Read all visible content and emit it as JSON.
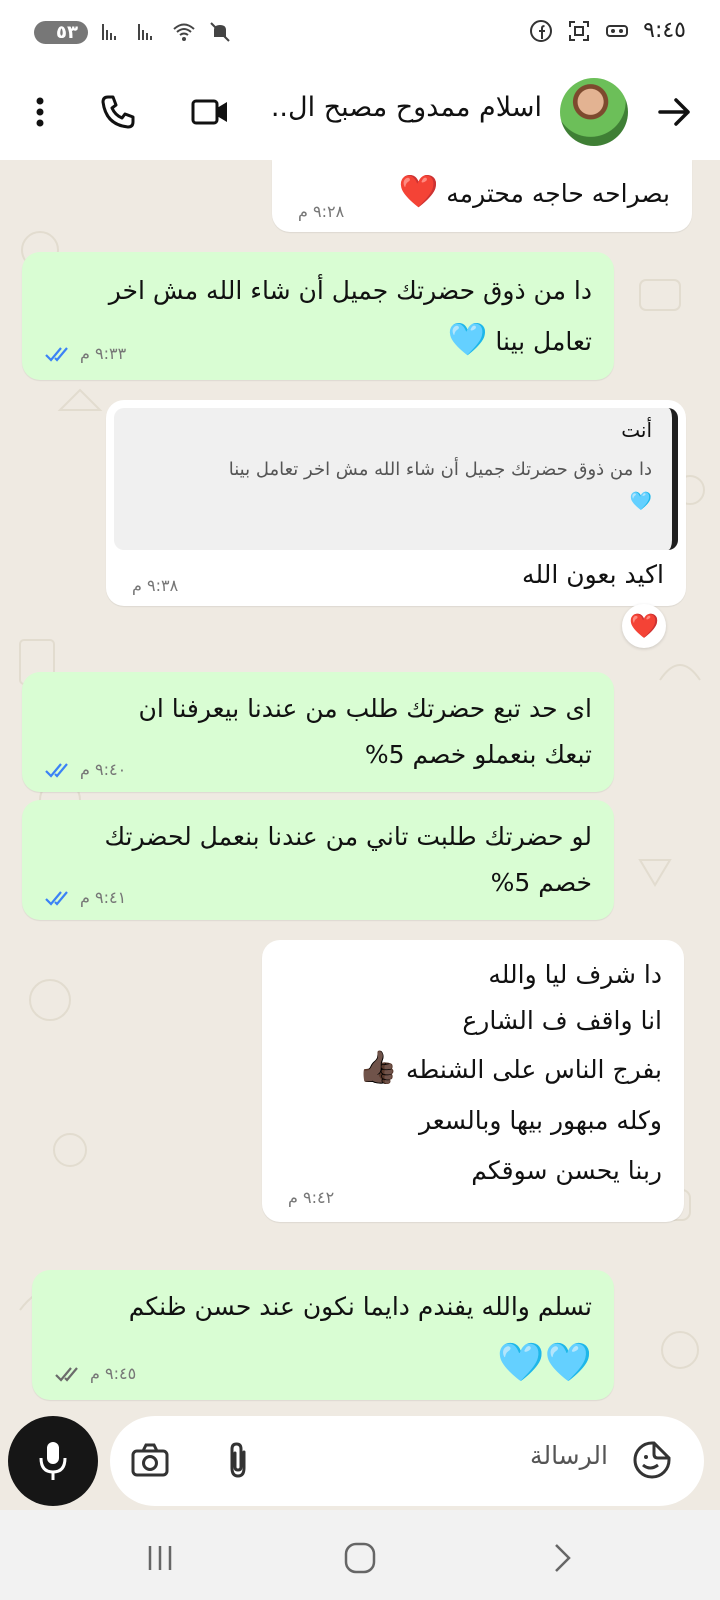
{
  "status_bar": {
    "time": "٩:٤٥",
    "battery": "٥٣"
  },
  "header": {
    "contact_name": "اسلام ممدوح مصبح ال.."
  },
  "messages": [
    {
      "dir": "in",
      "lines": [
        "بصراحه حاجه محترمه"
      ],
      "emoji": "❤️",
      "time": "٩:٢٨ م"
    },
    {
      "dir": "out",
      "lines": [
        "دا من ذوق حضرتك جميل أن شاء الله مش اخر",
        "تعامل بينا"
      ],
      "emoji": "🩵",
      "time": "٩:٣٣ م"
    },
    {
      "dir": "in",
      "quote_author": "أنت",
      "quote_text": "دا من ذوق حضرتك جميل أن شاء الله مش اخر تعامل بينا",
      "quote_emoji": "🩵",
      "lines": [
        "اكيد بعون الله"
      ],
      "time": "٩:٣٨ م",
      "reaction": "❤️"
    },
    {
      "dir": "out",
      "lines": [
        "اى حد تبع حضرتك طلب من عندنا بيعرفنا ان",
        "تبعك بنعملو خصم 5%"
      ],
      "time": "٩:٤٠ م"
    },
    {
      "dir": "out",
      "lines": [
        "لو حضرتك طلبت تاني من عندنا بنعمل لحضرتك",
        "خصم 5%"
      ],
      "time": "٩:٤١ م"
    },
    {
      "dir": "in",
      "lines": [
        "دا شرف ليا والله",
        "انا واقف ف الشارع",
        "بفرج الناس على الشنطه",
        "وكله مبهور بيها وبالسعر",
        "ربنا يحسن سوقكم"
      ],
      "emoji": "👍🏿",
      "time": "٩:٤٢ م"
    },
    {
      "dir": "out",
      "lines": [
        "تسلم والله يفندم دايما نكون عند حسن ظنكم"
      ],
      "emoji": "🩵🩵",
      "time": "٩:٤٥ م"
    }
  ],
  "composer": {
    "placeholder": "الرسالة"
  },
  "colors": {
    "outgoing_bubble": "#d9fdd3",
    "incoming_bubble": "#ffffff",
    "chat_background": "#efeae2",
    "read_ticks": "#3b82f6"
  }
}
